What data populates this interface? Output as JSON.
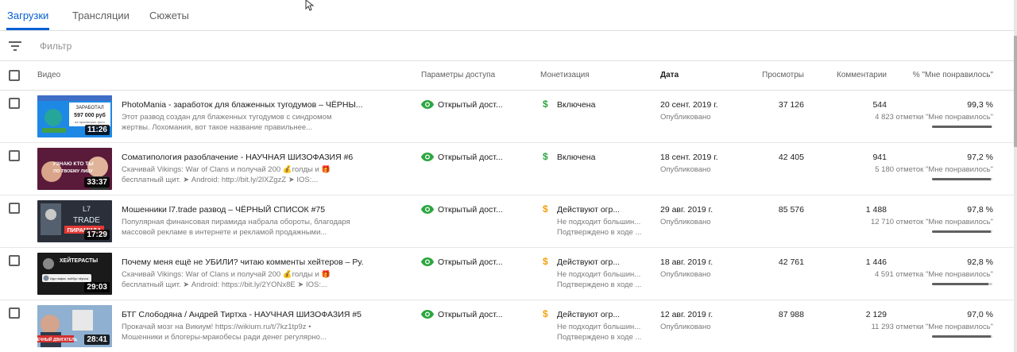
{
  "tabs": [
    {
      "label": "Загрузки",
      "active": true
    },
    {
      "label": "Трансляции",
      "active": false
    },
    {
      "label": "Сюжеты",
      "active": false
    }
  ],
  "filter": {
    "placeholder": "Фильтр",
    "icon": "filter-icon"
  },
  "columns": {
    "video": "Видео",
    "visibility": "Параметры доступа",
    "monetization": "Монетизация",
    "date": "Дата",
    "views": "Просмотры",
    "comments": "Комментарии",
    "likes": "% \"Мне понравилось\""
  },
  "colors": {
    "accent": "#065fd4",
    "visibility_icon": "#2ba640",
    "monetization_on": "#2ba640",
    "monetization_limited": "#f2a00c"
  },
  "videos": [
    {
      "title": "PhotoMania - заработок для блаженных тугодумов – ЧЁРНЫ...",
      "description": [
        "Этот развод создан для блаженных тугодумов с синдромом",
        "жертвы. Лохомания, вот такое название правильнее..."
      ],
      "duration": "11:26",
      "visibility": "Открытый дост...",
      "monetization": {
        "icon": "dollar-icon",
        "status": "on",
        "label": "Включена",
        "sub": []
      },
      "date": "20 сент. 2019 г.",
      "date_status": "Опубликовано",
      "views": "37 126",
      "comments": "544",
      "likes_pct": "99,3 %",
      "likes_count": "4 823 отметки \"Мне понравилось\"",
      "likes_ratio": 0.993
    },
    {
      "title": "Соматипология разоблачение - НАУЧНАЯ ШИЗОФАЗИЯ #6",
      "description": [
        "Скачивай Vikings: War of Clans и получай 200 💰голды и 🎁",
        "бесплатный щит. ➤ Android: http://bit.ly/2lXZgzZ ➤ IOS:..."
      ],
      "duration": "33:37",
      "visibility": "Открытый дост...",
      "monetization": {
        "icon": "dollar-icon",
        "status": "on",
        "label": "Включена",
        "sub": []
      },
      "date": "18 сент. 2019 г.",
      "date_status": "Опубликовано",
      "views": "42 405",
      "comments": "941",
      "likes_pct": "97,2 %",
      "likes_count": "5 180 отметок \"Мне понравилось\"",
      "likes_ratio": 0.972
    },
    {
      "title": "Мошенники l7.trade развод – ЧЁРНЫЙ СПИСОК #75",
      "description": [
        "Популярная финансовая пирамида набрала обороты, благодаря",
        "массовой рекламе в интернете и рекламой продажными..."
      ],
      "duration": "17:29",
      "visibility": "Открытый дост...",
      "monetization": {
        "icon": "dollar-icon",
        "status": "limited",
        "label": "Действуют огр...",
        "sub": [
          "Не подходит большин...",
          "Подтверждено в ходе ..."
        ]
      },
      "date": "29 авг. 2019 г.",
      "date_status": "Опубликовано",
      "views": "85 576",
      "comments": "1 488",
      "likes_pct": "97,8 %",
      "likes_count": "12 710 отметок \"Мне понравилось\"",
      "likes_ratio": 0.978
    },
    {
      "title": "Почему меня ещё не УБИЛИ? читаю комменты хейтеров – Ру...",
      "description": [
        "Скачивай Vikings: War of Clans и получай 200 💰голды и 🎁",
        "бесплатный щит. ➤ Android: https://bit.ly/2YONx8E ➤ IOS:..."
      ],
      "duration": "29:03",
      "visibility": "Открытый дост...",
      "monetization": {
        "icon": "dollar-icon",
        "status": "limited",
        "label": "Действуют огр...",
        "sub": [
          "Не подходит большин...",
          "Подтверждено в ходе ..."
        ]
      },
      "date": "18 авг. 2019 г.",
      "date_status": "Опубликовано",
      "views": "42 761",
      "comments": "1 446",
      "likes_pct": "92,8 %",
      "likes_count": "4 591 отметка \"Мне понравилось\"",
      "likes_ratio": 0.928
    },
    {
      "title": "БТГ Слободяна / Андрей Тиртха - НАУЧНАЯ ШИЗОФАЗИЯ #5",
      "description": [
        "Прокачай мозг на Викиум! https://wikium.ru/t/7kz1tp9z •",
        "Мошенники и блогеры-мракобесы ради денег регулярно..."
      ],
      "duration": "28:41",
      "visibility": "Открытый дост...",
      "monetization": {
        "icon": "dollar-icon",
        "status": "limited",
        "label": "Действуют огр...",
        "sub": [
          "Не подходит большин...",
          "Подтверждено в ходе ..."
        ]
      },
      "date": "12 авг. 2019 г.",
      "date_status": "Опубликовано",
      "views": "87 988",
      "comments": "2 129",
      "likes_pct": "97,0 %",
      "likes_count": "11 293 отметки \"Мне понравилось\"",
      "likes_ratio": 0.97
    }
  ],
  "thumbnails": [
    {
      "text_lines": [
        "ЗАРАБОТАЛ",
        "597 000 руб",
        "на просмотрах фото"
      ],
      "bg": "#1e88e5"
    },
    {
      "text_lines": [
        "УЗНАЮ КТО ТЫ",
        "ПО ТВОЕМУ ЛИЦУ"
      ],
      "bg": "#5a1a3a"
    },
    {
      "text_lines": [
        "L7",
        "TRADE",
        "ПИРАМИДА"
      ],
      "bg": "#2a2f3a"
    },
    {
      "text_lines": [
        "ХЕЙТЕРАСТЫ",
        "Иди нафиг, поёбус пёрчик"
      ],
      "bg": "#1a1a1a"
    },
    {
      "text_lines": [
        "ВЕЧНЫЙ ДВИГАТЕЛЬ"
      ],
      "bg": "#c8c8c8"
    }
  ]
}
